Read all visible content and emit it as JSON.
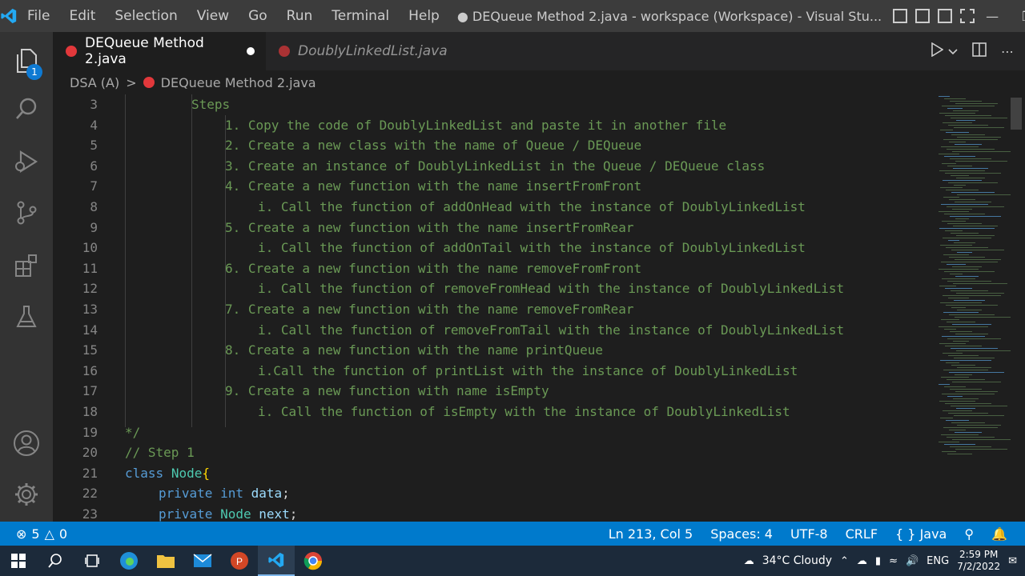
{
  "window": {
    "title": "● DEQueue Method 2.java - workspace (Workspace) - Visual Stu...",
    "menu": [
      "File",
      "Edit",
      "Selection",
      "View",
      "Go",
      "Run",
      "Terminal",
      "Help"
    ]
  },
  "activity": {
    "badge": "1"
  },
  "tabs": [
    {
      "label": "DEQueue Method 2.java",
      "active": true,
      "modified": true
    },
    {
      "label": "DoublyLinkedList.java",
      "active": false
    }
  ],
  "breadcrumb": {
    "folder": "DSA (A)",
    "sep": ">",
    "file": "DEQueue Method 2.java"
  },
  "editor": {
    "lines": [
      {
        "n": "3",
        "text": "Steps"
      },
      {
        "n": "4",
        "text": "1. Copy the code of DoublyLinkedList and paste it in another file"
      },
      {
        "n": "5",
        "text": "2. Create a new class with the name of Queue / DEQueue"
      },
      {
        "n": "6",
        "text": "3. Create an instance of DoublyLinkedList in the Queue / DEQueue class"
      },
      {
        "n": "7",
        "text": "4. Create a new function with the name insertFromFront"
      },
      {
        "n": "8",
        "text": "i. Call the function of addOnHead with the instance of DoublyLinkedList"
      },
      {
        "n": "9",
        "text": "5. Create a new function with the name insertFromRear"
      },
      {
        "n": "10",
        "text": "i. Call the function of addOnTail with the instance of DoublyLinkedList"
      },
      {
        "n": "11",
        "text": "6. Create a new function with the name removeFromFront"
      },
      {
        "n": "12",
        "text": "i. Call the function of removeFromHead with the instance of DoublyLinkedList"
      },
      {
        "n": "13",
        "text": "7. Create a new function with the name removeFromRear"
      },
      {
        "n": "14",
        "text": "i. Call the function of removeFromTail with the instance of DoublyLinkedList"
      },
      {
        "n": "15",
        "text": "8. Create a new function with the name printQueue"
      },
      {
        "n": "16",
        "text": "i.Call the function of printList with the instance of DoublyLinkedList"
      },
      {
        "n": "17",
        "text": "9. Create a new function with name isEmpty"
      },
      {
        "n": "18",
        "text": "i. Call the function of isEmpty with the instance of DoublyLinkedList"
      },
      {
        "n": "19",
        "text": "*/"
      },
      {
        "n": "20",
        "text": "// Step 1"
      },
      {
        "n": "21",
        "kw": "class",
        "type": "Node",
        "brace": "{"
      },
      {
        "n": "22",
        "kw": "private",
        "kw2": "int",
        "var": "data",
        "punc": ";"
      },
      {
        "n": "23",
        "kw": "private",
        "type": "Node",
        "var": "next",
        "punc": ";"
      }
    ]
  },
  "status": {
    "errors": "5",
    "warnings": "0",
    "position": "Ln 213, Col 5",
    "spaces": "Spaces: 4",
    "encoding": "UTF-8",
    "eol": "CRLF",
    "language": "Java"
  },
  "taskbar": {
    "weather": "34°C  Cloudy",
    "lang": "ENG",
    "time": "2:59 PM",
    "date": "7/2/2022"
  },
  "colors": {
    "accent": "#007acc",
    "comment": "#6a9955",
    "keyword": "#569cd6",
    "type": "#4ec9b0"
  }
}
